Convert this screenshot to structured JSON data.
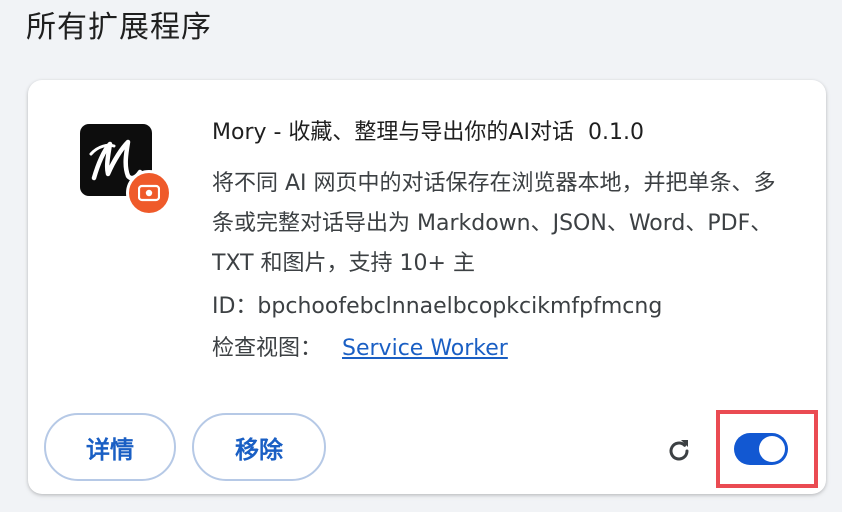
{
  "section": {
    "title": "所有扩展程序"
  },
  "extension": {
    "name": "Mory - 收藏、整理与导出你的AI对话",
    "version": "0.1.0",
    "description": "将不同 AI 网页中的对话保存在浏览器本地，并把单条、多条或完整对话导出为 Markdown、JSON、Word、PDF、TXT 和图片，支持 10+ 主",
    "id_text": "ID：bpchoofebclnnaelbcopkcikmfpfmcng",
    "inspect_label": "检查视图：",
    "inspect_link": "Service Worker",
    "icon": "mory-logo-icon",
    "badge_icon": "camera-badge-icon",
    "enabled": true
  },
  "actions": {
    "details_label": "详情",
    "remove_label": "移除",
    "reload_icon": "reload-icon"
  },
  "colors": {
    "accent": "#1a5fc4",
    "toggle_on": "#1258d2",
    "badge": "#ef5a2a",
    "highlight": "#ea4b52"
  }
}
